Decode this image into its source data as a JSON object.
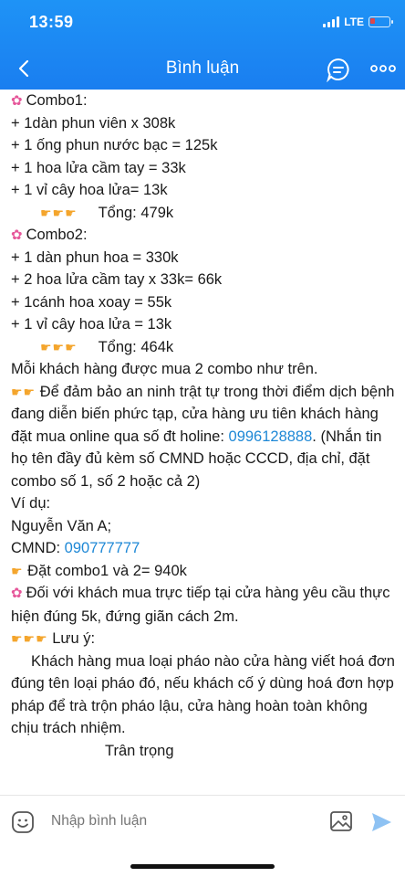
{
  "status_bar": {
    "time": "13:59",
    "network": "LTE"
  },
  "header": {
    "title": "Bình luận"
  },
  "post": {
    "combo1_title": "Combo1:",
    "combo1_items": [
      "+ 1dàn phun viên x 308k",
      "+ 1 ống phun nước bạc = 125k",
      "+ 1 hoa lửa cầm tay = 33k",
      "+ 1 vỉ cây hoa lửa= 13k"
    ],
    "combo1_total": "Tổng: 479k",
    "combo2_title": "Combo2:",
    "combo2_items": [
      "+ 1 dàn phun hoa = 330k",
      "+ 2 hoa lửa cầm tay x 33k= 66k",
      "+ 1cánh hoa xoay = 55k",
      "+ 1 vỉ cây hoa lửa = 13k"
    ],
    "combo2_total": "Tổng: 464k",
    "limit_note": "Mỗi khách hàng được mua 2 combo như trên.",
    "security_note": "Để đảm bảo an ninh trật tự trong thời điểm dịch bệnh đang diễn biến phức tạp, cửa hàng ưu tiên khách hàng đặt mua online qua số đt holine:",
    "hotline": "0996128888",
    "order_instructions": ". (Nhắn tin họ tên đầy đủ kèm số CMND hoặc CCCD, địa chỉ, đặt combo số 1, số 2 hoặc cả 2)",
    "example_label": "Ví dụ:",
    "example_name": "Nguyễn Văn A;",
    "example_id_label": "CMND: ",
    "example_id_value": "090777777",
    "example_order": "Đặt combo1 và 2= 940k",
    "in_store_note": "Đối với khách mua trực tiếp tại cửa hàng yêu cầu thực hiện đúng 5k, đứng giãn cách 2m.",
    "warning_label": "Lưu ý:",
    "warning_text": "Khách hàng mua loại pháo nào cửa hàng viết hoá đơn đúng tên loại pháo đó, nếu khách cố ý dùng hoá đơn hợp pháp để trà trộn pháo lậu, cửa hàng hoàn toàn không chịu trách nhiệm.",
    "signature": "Trân trọng"
  },
  "composer": {
    "placeholder": "Nhập bình luận"
  },
  "icons": {
    "flower": "cherry-blossom-emoji",
    "hand": "backhand-index-pointing-right-emoji"
  },
  "colors": {
    "header": "#1a7ef0",
    "link": "#1e88d6",
    "send": "#8ec2f3"
  }
}
